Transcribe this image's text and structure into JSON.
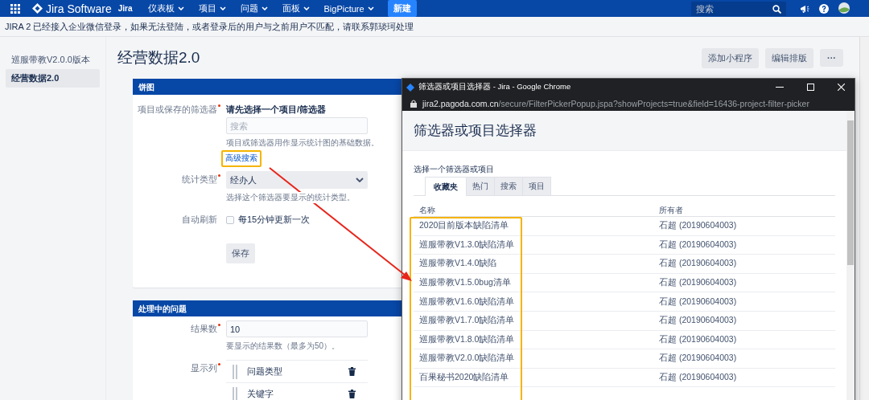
{
  "top_nav": {
    "app_name": "Jira Software",
    "product": "Jira",
    "menus": [
      {
        "label": "仪表板"
      },
      {
        "label": "项目"
      },
      {
        "label": "问题"
      },
      {
        "label": "面板"
      },
      {
        "label": "BigPicture"
      }
    ],
    "create_button": "新建",
    "search": {
      "placeholder": "搜索"
    }
  },
  "banner": "JIRA 2 已经接入企业微信登录，如果无法登陆，或者登录后的用户与之前用户不匹配，请联系郭琰珂处理",
  "sidebar": {
    "items": [
      {
        "label": "巡服带教V2.0.0版本",
        "selected": false
      },
      {
        "label": "经营数据2.0",
        "selected": true
      }
    ]
  },
  "dashboard": {
    "title": "经营数据2.0",
    "buttons": [
      "添加小程序",
      "编辑排版"
    ],
    "more_button": "···"
  },
  "gadgets": [
    {
      "title": "饼图",
      "fields": [
        {
          "kind": "filter",
          "label": "项目或保存的筛选器",
          "required": true,
          "value": "请先选择一个项目/筛选器",
          "placeholder": "搜索",
          "help": "项目或筛选器用作显示统计图的基础数据。",
          "link": "高级搜索"
        },
        {
          "kind": "select",
          "label": "统计类型",
          "required": true,
          "value": "经办人",
          "help": "选择这个筛选器要显示的统计类型。"
        },
        {
          "kind": "checkbox",
          "label": "自动刷新",
          "required": false,
          "checked": false,
          "text": "每15分钟更新一次"
        }
      ],
      "save_button": "保存"
    },
    {
      "title": "处理中的问题",
      "fields": [
        {
          "kind": "text",
          "label": "结果数",
          "required": true,
          "value": "10",
          "help": "要显示的结果数（最多为50）。"
        },
        {
          "kind": "columns",
          "label": "显示列",
          "required": true,
          "columns": [
            "问题类型",
            "关键字"
          ]
        }
      ]
    }
  ],
  "popup": {
    "title": "筛选器或项目选择器 - Jira - Google Chrome",
    "url_host": "jira2.pagoda.com.cn",
    "url_path": "/secure/FilterPickerPopup.jspa?showProjects=true&field=16436-project-filter-picker",
    "heading": "筛选器或项目选择器",
    "prompt": "选择一个筛选器或项目",
    "tabs": [
      {
        "label": "收藏夹",
        "selected": true
      },
      {
        "label": "热门",
        "selected": false
      },
      {
        "label": "搜索",
        "selected": false
      },
      {
        "label": "项目",
        "selected": false
      }
    ],
    "table": {
      "columns": [
        "名称",
        "所有者"
      ],
      "rows": [
        {
          "name": "2020目前版本缺陷清单",
          "owner": "石超 (20190604003)"
        },
        {
          "name": "巡服带教V1.3.0缺陷清单",
          "owner": "石超 (20190604003)"
        },
        {
          "name": "巡服带教V1.4.0缺陷",
          "owner": "石超 (20190604003)"
        },
        {
          "name": "巡服带教V1.5.0bug清单",
          "owner": "石超 (20190604003)"
        },
        {
          "name": "巡服带教V1.6.0缺陷清单",
          "owner": "石超 (20190604003)"
        },
        {
          "name": "巡服带教V1.7.0缺陷清单",
          "owner": "石超 (20190604003)"
        },
        {
          "name": "巡服带教V1.8.0缺陷清单",
          "owner": "石超 (20190604003)"
        },
        {
          "name": "巡服带教V2.0.0缺陷清单",
          "owner": "石超 (20190604003)"
        },
        {
          "name": "百果秘书2020缺陷清单",
          "owner": "石超 (20190604003)"
        }
      ]
    }
  }
}
